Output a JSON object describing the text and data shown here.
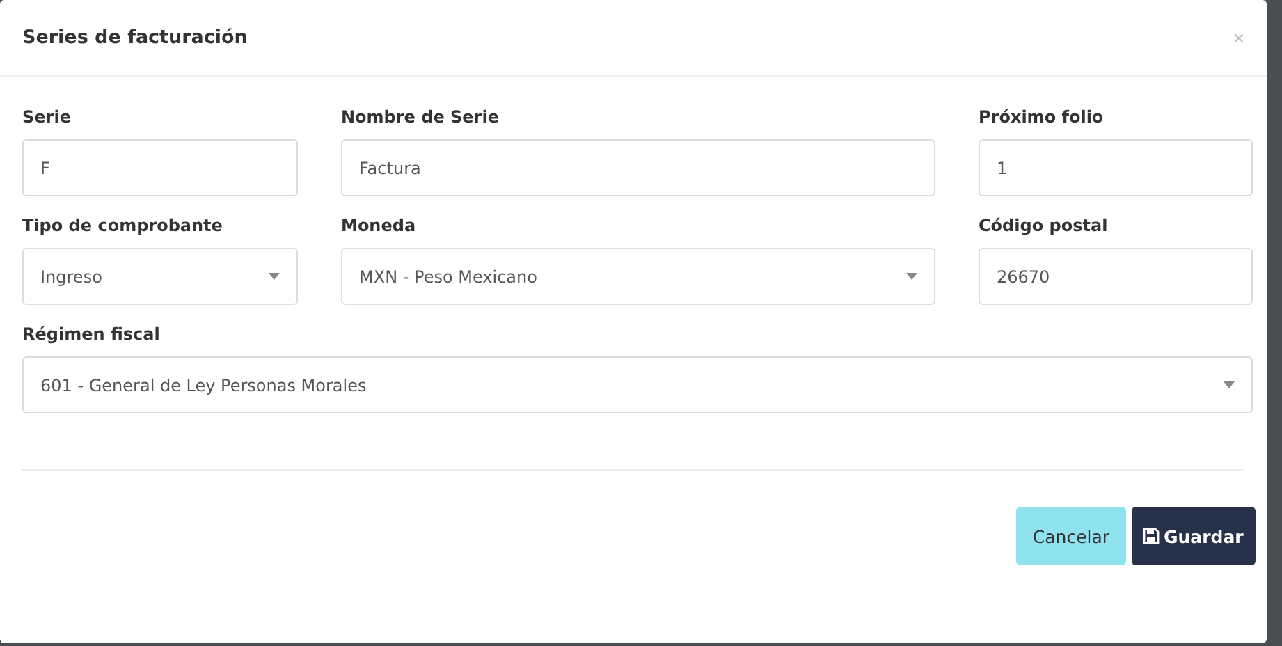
{
  "dialog": {
    "title": "Series de facturación",
    "close": "×"
  },
  "fields": [
    {
      "label": "Serie",
      "value": "F",
      "kind": "text"
    },
    {
      "label": "Nombre de Serie",
      "value": "Factura",
      "kind": "text"
    },
    {
      "label": "Próximo folio",
      "value": "1",
      "kind": "text"
    },
    {
      "label": "Tipo de comprobante",
      "value": "Ingreso",
      "kind": "select"
    },
    {
      "label": "Moneda",
      "value": "MXN - Peso Mexicano",
      "kind": "select"
    },
    {
      "label": "Código postal",
      "value": "26670",
      "kind": "text"
    },
    {
      "label": "Régimen fiscal",
      "value": "601 - General de Ley Personas Morales",
      "kind": "select"
    }
  ],
  "buttons": [
    {
      "label": "Cancelar",
      "kind": "cancel"
    },
    {
      "label": "Guardar",
      "kind": "save"
    }
  ]
}
